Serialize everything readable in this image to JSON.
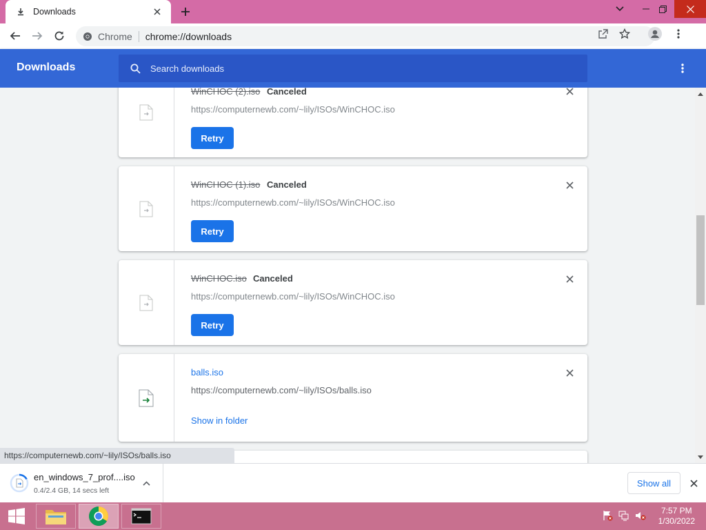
{
  "browser": {
    "tab_title": "Downloads",
    "site_chip": "Chrome",
    "url": "chrome://downloads",
    "accent_color": "#d46ba6"
  },
  "header": {
    "title": "Downloads",
    "search_placeholder": "Search downloads",
    "color": "#3367d6"
  },
  "downloads": [
    {
      "name": "WinCHOC (2).iso",
      "status": "Canceled",
      "url": "https://computernewb.com/~lily/ISOs/WinCHOC.iso",
      "action": "Retry"
    },
    {
      "name": "WinCHOC (1).iso",
      "status": "Canceled",
      "url": "https://computernewb.com/~lily/ISOs/WinCHOC.iso",
      "action": "Retry"
    },
    {
      "name": "WinCHOC.iso",
      "status": "Canceled",
      "url": "https://computernewb.com/~lily/ISOs/WinCHOC.iso",
      "action": "Retry"
    },
    {
      "name": "balls.iso",
      "status": "",
      "url": "https://computernewb.com/~lily/ISOs/balls.iso",
      "action": "Show in folder"
    }
  ],
  "status_bubble": "https://computernewb.com/~lily/ISOs/balls.iso",
  "shelf": {
    "file_name": "en_windows_7_prof....iso",
    "progress_text": "0.4/2.4 GB, 14 secs left",
    "progress_fraction": 0.17,
    "show_all_label": "Show all"
  },
  "taskbar": {
    "time": "7:57 PM",
    "date": "1/30/2022"
  }
}
